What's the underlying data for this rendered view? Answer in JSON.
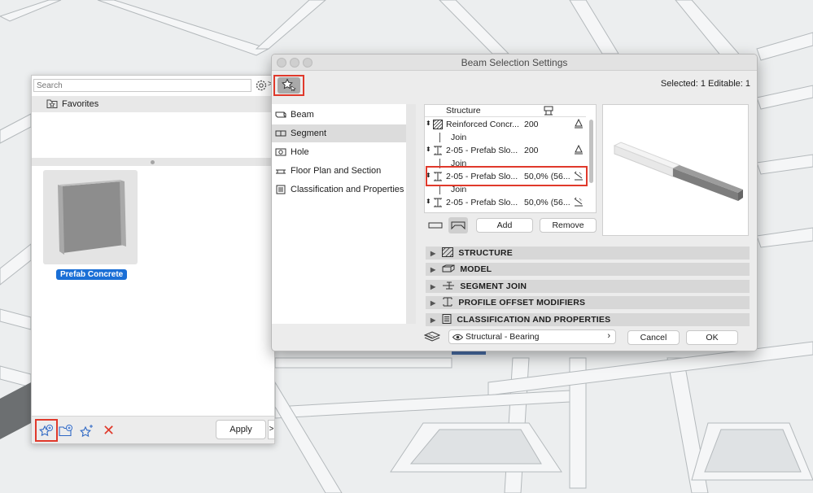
{
  "favorites_panel": {
    "search_placeholder": "Search",
    "header_label": "Favorites",
    "thumbnail_label": "Prefab Concrete",
    "apply_label": "Apply",
    "more_glyph": ">",
    "arrow_glyph": ">",
    "delete_glyph": "✕"
  },
  "dialog": {
    "title": "Beam Selection Settings",
    "selected_info": "Selected: 1 Editable: 1",
    "nav": [
      {
        "label": "Beam",
        "icon": "beam-icon"
      },
      {
        "label": "Segment",
        "icon": "segment-icon",
        "active": true
      },
      {
        "label": "Hole",
        "icon": "hole-icon"
      },
      {
        "label": "Floor Plan and Section",
        "icon": "floor-plan-icon"
      },
      {
        "label": "Classification and Properties",
        "icon": "classification-icon"
      }
    ],
    "segment_list": {
      "header": "Structure",
      "rows": [
        {
          "name": "Reinforced Concr...",
          "value": "200",
          "join": "Join"
        },
        {
          "name": "2-05 - Prefab Slo...",
          "value": "200",
          "join": "Join"
        },
        {
          "name": "2-05 - Prefab Slo...",
          "value": "50,0% (56...",
          "join": "Join"
        },
        {
          "name": "2-05 - Prefab Slo...",
          "value": "50,0% (56..."
        }
      ]
    },
    "add_label": "Add",
    "remove_label": "Remove",
    "sections": [
      {
        "label": "STRUCTURE",
        "icon": "hatch-icon"
      },
      {
        "label": "MODEL",
        "icon": "model-icon"
      },
      {
        "label": "SEGMENT JOIN",
        "icon": "segment-join-icon"
      },
      {
        "label": "PROFILE OFFSET MODIFIERS",
        "icon": "profile-icon"
      },
      {
        "label": "CLASSIFICATION AND PROPERTIES",
        "icon": "classification-icon"
      }
    ],
    "layer_value": "Structural - Bearing",
    "layer_chevron": "›",
    "cancel_label": "Cancel",
    "ok_label": "OK"
  },
  "colors": {
    "highlight": "#e0392b",
    "selection_blue": "#1a6fd6"
  }
}
